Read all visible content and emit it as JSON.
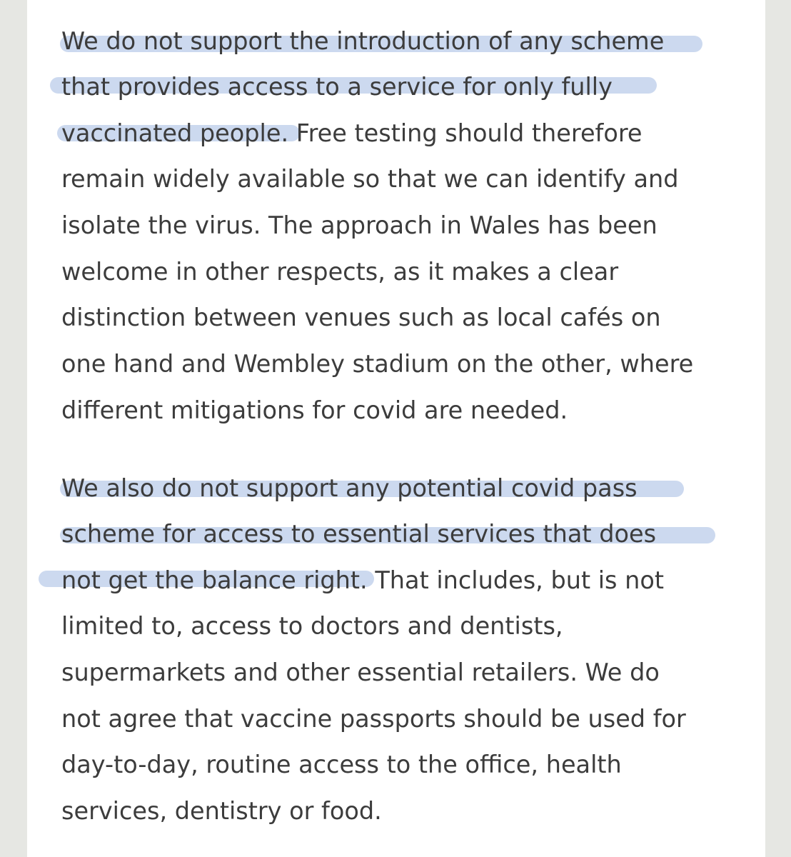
{
  "paragraphs": [
    {
      "lines": [
        "We do not support the introduction of any scheme",
        "that provides access to a service for only fully",
        "vaccinated people. Free testing should therefore",
        "remain widely available so that we can identify and",
        "isolate the virus. The approach in Wales has been",
        "welcome in other respects, as it makes a clear",
        "distinction between venues such as local cafés on",
        "one hand and Wembley stadium on the other, where",
        "different mitigations for covid are needed."
      ]
    },
    {
      "lines": [
        "We also do not support any potential covid pass",
        "scheme for access to essential services that does",
        "not get the balance right. That includes, but is not",
        "limited to, access to doctors and dentists,",
        "supermarkets and other essential retailers. We do",
        "not agree that vaccine passports should be used for",
        "day-to-day, routine access to the office, health",
        "services, dentistry or food."
      ]
    }
  ],
  "highlight_color": "#c9d7ee",
  "background_color": "#e6e7e3",
  "page_color": "#ffffff"
}
